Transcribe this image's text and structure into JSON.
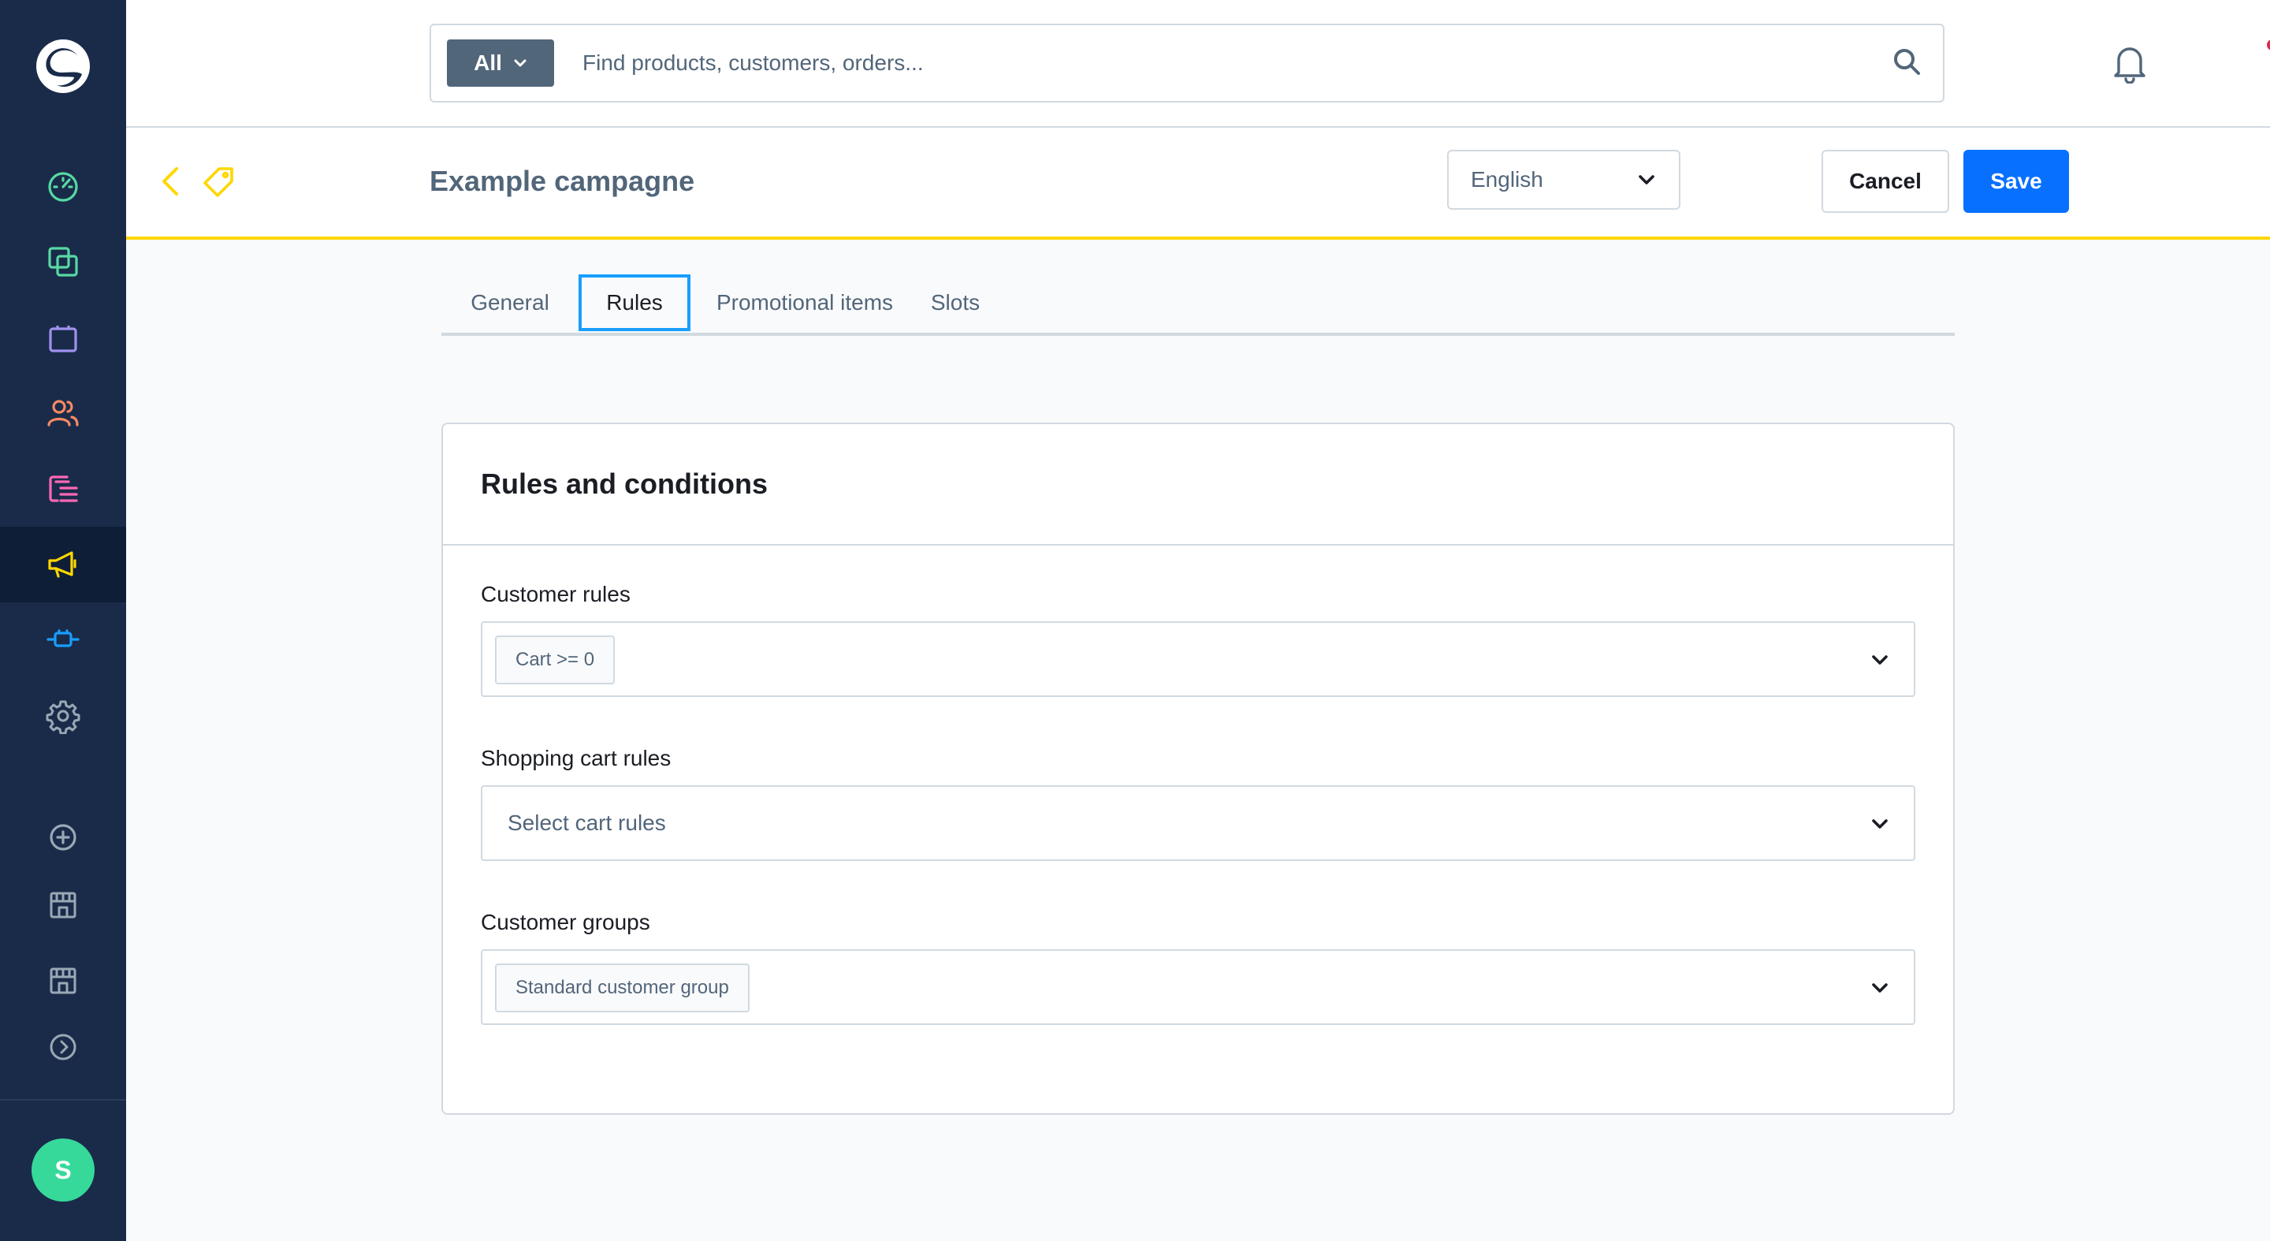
{
  "brand": {
    "logo_icon": "shopware-logo-icon",
    "accent_color": "#ffd700",
    "primary_color": "#0870ff"
  },
  "sidebar": {
    "items": [
      {
        "name": "dashboard",
        "icon": "dashboard-gauge-icon",
        "color": "#57d9a3"
      },
      {
        "name": "catalogues",
        "icon": "catalogues-icon",
        "color": "#57d9a3"
      },
      {
        "name": "orders",
        "icon": "orders-bag-icon",
        "color": "#a092f0"
      },
      {
        "name": "customers",
        "icon": "customers-icon",
        "color": "#f88962"
      },
      {
        "name": "content",
        "icon": "content-icon",
        "color": "#ff68b4"
      },
      {
        "name": "marketing",
        "icon": "megaphone-icon",
        "color": "#ffd700",
        "active": true
      },
      {
        "name": "extensions",
        "icon": "plug-icon",
        "color": "#189eff"
      },
      {
        "name": "settings",
        "icon": "gear-icon",
        "color": "#9aa8b5"
      },
      {
        "name": "add-sales-channel",
        "icon": "plus-circle-icon",
        "color": "#9aa8b5"
      },
      {
        "name": "sales-channel-1",
        "icon": "storefront-icon",
        "color": "#9aa8b5"
      },
      {
        "name": "sales-channel-2",
        "icon": "storefront-icon",
        "color": "#9aa8b5"
      },
      {
        "name": "expand",
        "icon": "chevron-right-circle-icon",
        "color": "#9aa8b5"
      }
    ],
    "avatar_initial": "S"
  },
  "search": {
    "type_label": "All",
    "placeholder": "Find products, customers, orders..."
  },
  "smartbar": {
    "title": "Example campagne",
    "language": "English",
    "cancel_label": "Cancel",
    "save_label": "Save"
  },
  "tabs": [
    {
      "label": "General",
      "active": false
    },
    {
      "label": "Rules",
      "active": true
    },
    {
      "label": "Promotional items",
      "active": false
    },
    {
      "label": "Slots",
      "active": false
    }
  ],
  "card": {
    "title": "Rules and conditions",
    "fields": [
      {
        "label": "Customer rules",
        "chips": [
          "Cart >= 0"
        ],
        "placeholder": ""
      },
      {
        "label": "Shopping cart rules",
        "chips": [],
        "placeholder": "Select cart rules"
      },
      {
        "label": "Customer groups",
        "chips": [
          "Standard customer group"
        ],
        "placeholder": ""
      }
    ]
  }
}
